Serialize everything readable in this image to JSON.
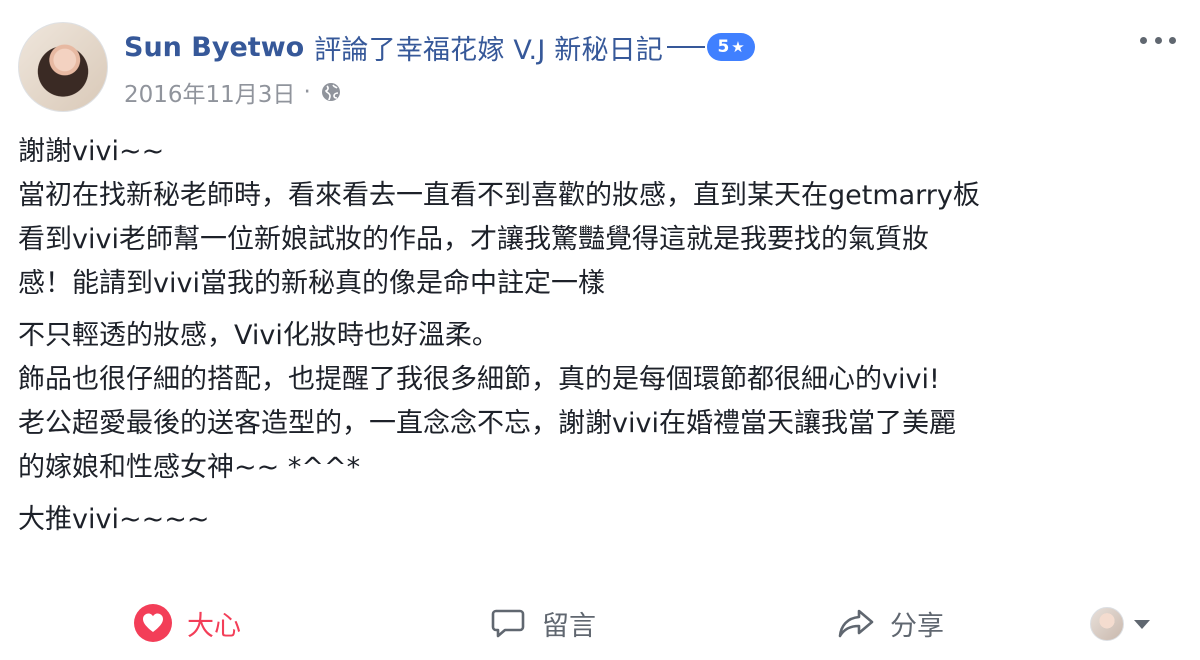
{
  "post": {
    "author": "Sun Byetwo",
    "action_text": "評論了幸福花嫁 V.J 新秘日記",
    "rating": "5",
    "date": "2016年11月3日",
    "meta_separator": "·",
    "paragraphs": [
      "謝謝vivi~~\n當初在找新秘老師時，看來看去一直看不到喜歡的妝感，直到某天在getmarry板\n看到vivi老師幫一位新娘試妝的作品，才讓我驚豔覺得這就是我要找的氣質妝\n感！能請到vivi當我的新秘真的像是命中註定一樣",
      "不只輕透的妝感，Vivi化妝時也好溫柔。\n飾品也很仔細的搭配，也提醒了我很多細節，真的是每個環節都很細心的vivi!\n老公超愛最後的送客造型的，一直念念不忘，謝謝vivi在婚禮當天讓我當了美麗\n的嫁娘和性感女神~~ *^^*",
      "大推vivi~~~~"
    ]
  },
  "actions": {
    "like_label": "大心",
    "comment_label": "留言",
    "share_label": "分享"
  },
  "colors": {
    "link": "#365899",
    "badge": "#4080ff",
    "love": "#f33e58",
    "meta": "#90949c"
  },
  "icons": [
    "globe-icon",
    "more-options-icon",
    "heart-icon",
    "comment-icon",
    "share-icon",
    "caret-down-icon"
  ]
}
